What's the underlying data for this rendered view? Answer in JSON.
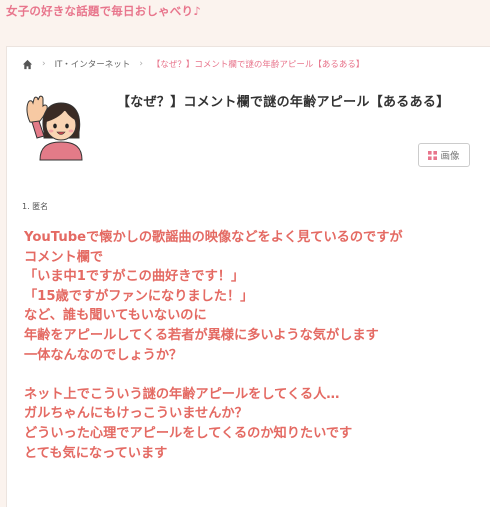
{
  "site": {
    "tagline": "女子の好きな話題で毎日おしゃべり♪"
  },
  "breadcrumb": {
    "items": [
      "IT・インターネット"
    ],
    "current": "【なぜ？】コメント欄で謎の年齢アピール【あるある】"
  },
  "topic": {
    "title": "【なぜ？】コメント欄で謎の年齢アピール【あるある】",
    "image_button_label": "画像"
  },
  "comment": {
    "number_label": "1. 匿名",
    "lines": [
      "YouTubeで懐かしの歌謡曲の映像などをよく見ているのですが",
      "コメント欄で",
      "「いま中1ですがこの曲好きです！」",
      "「15歳ですがファンになりました！」",
      "など、誰も聞いてもいないのに",
      "年齢をアピールしてくる若者が異様に多いような気がします",
      "一体なんなのでしょうか？",
      "",
      "ネット上でこういう謎の年齢アピールをしてくる人…",
      "ガルちゃんにもけっこういませんか？",
      "どういった心理でアピールをしてくるのか知りたいです",
      "とても気になっています"
    ]
  },
  "colors": {
    "accent": "#e8758c",
    "comment_text": "#e46a63",
    "page_bg": "#fbf3ee"
  },
  "icons": {
    "home": "home-icon",
    "image": "grid-icon"
  }
}
